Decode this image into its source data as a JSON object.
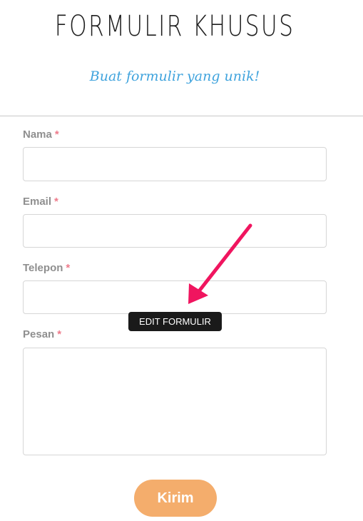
{
  "header": {
    "title": "FORMULIR KHUSUS",
    "subtitle": "Buat formulir yang unik!"
  },
  "form": {
    "required_marker": "*",
    "fields": [
      {
        "label": "Nama",
        "value": "",
        "type": "text"
      },
      {
        "label": "Email",
        "value": "",
        "type": "text"
      },
      {
        "label": "Telepon",
        "value": "",
        "type": "text"
      },
      {
        "label": "Pesan",
        "value": "",
        "type": "textarea"
      }
    ],
    "submit_label": "Kirim"
  },
  "tooltip": {
    "label": "EDIT FORMULIR"
  },
  "colors": {
    "title": "#1e1e1e",
    "subtitle": "#3fa3dd",
    "label": "#8f8f8f",
    "required": "#ee7b8b",
    "arrow": "#f0155f",
    "submit_bg": "#f4ad6c",
    "tooltip_bg": "#1a1a1a"
  }
}
